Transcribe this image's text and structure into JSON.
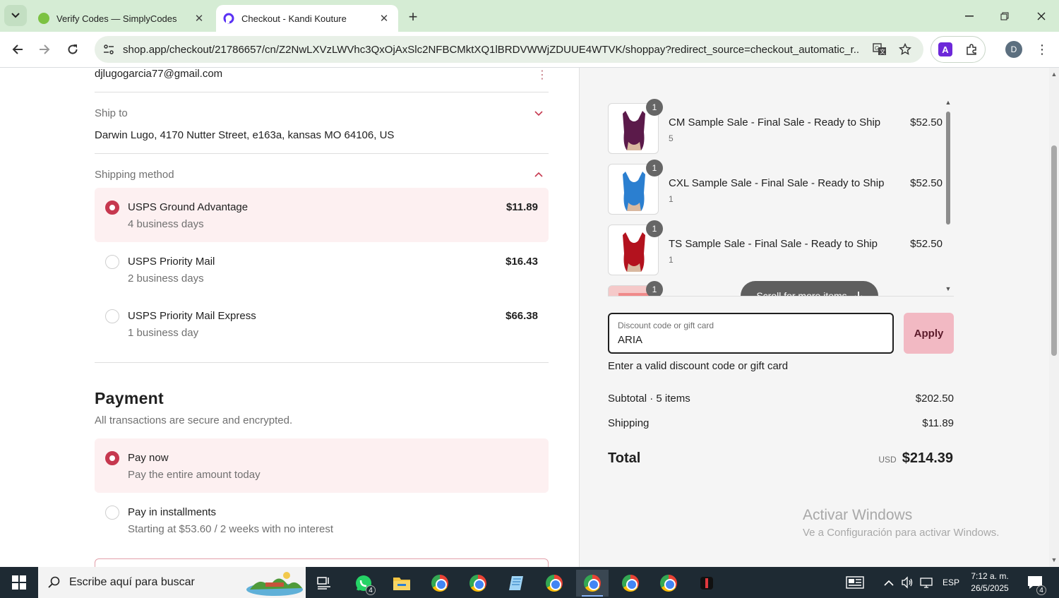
{
  "browser": {
    "tabs": [
      {
        "title": "Verify Codes — SimplyCodes",
        "active": false
      },
      {
        "title": "Checkout - Kandi Kouture",
        "active": true
      }
    ],
    "url": "shop.app/checkout/21786657/cn/Z2NwLXVzLWVhc3QxOjAxSlc2NFBCMktXQ1lBRDVWWjZDUUE4WTVK/shoppay?redirect_source=checkout_automatic_r...",
    "profile_initial": "D"
  },
  "contact": {
    "email": "djlugogarcia77@gmail.com"
  },
  "ship_to": {
    "label": "Ship to",
    "address": "Darwin Lugo, 4170 Nutter Street, e163a, kansas MO 64106, US"
  },
  "shipping": {
    "label": "Shipping method",
    "options": [
      {
        "title": "USPS Ground Advantage",
        "sub": "4 business days",
        "price": "$11.89",
        "selected": true
      },
      {
        "title": "USPS Priority Mail",
        "sub": "2 business days",
        "price": "$16.43",
        "selected": false
      },
      {
        "title": "USPS Priority Mail Express",
        "sub": "1 business day",
        "price": "$66.38",
        "selected": false
      }
    ]
  },
  "payment": {
    "heading": "Payment",
    "sub": "All transactions are secure and encrypted.",
    "options": [
      {
        "title": "Pay now",
        "sub": "Pay the entire amount today",
        "selected": true
      },
      {
        "title": "Pay in installments",
        "sub": "Starting at $53.60 / 2 weeks with no interest",
        "selected": false
      }
    ]
  },
  "order": {
    "items": [
      {
        "qty": "1",
        "name": "CM Sample Sale - Final Sale - Ready to Ship",
        "variant": "5",
        "price": "$52.50",
        "color": "#5b1a4a"
      },
      {
        "qty": "1",
        "name": "CXL Sample Sale - Final Sale - Ready to Ship",
        "variant": "1",
        "price": "$52.50",
        "color": "#2b7fd0"
      },
      {
        "qty": "1",
        "name": "TS Sample Sale - Final Sale - Ready to Ship",
        "variant": "1",
        "price": "$52.50",
        "color": "#b3121e"
      },
      {
        "qty": "1",
        "name": "",
        "variant": "",
        "price": "",
        "color": "#f08a8a"
      }
    ],
    "scroll_hint": "Scroll for more items",
    "discount": {
      "label": "Discount code or gift card",
      "value": "ARIA",
      "apply": "Apply",
      "error": "Enter a valid discount code or gift card"
    },
    "subtotal_label": "Subtotal · 5 items",
    "subtotal": "$202.50",
    "shipping_label": "Shipping",
    "shipping": "$11.89",
    "total_label": "Total",
    "currency": "USD",
    "total": "$214.39"
  },
  "watermark": {
    "line1": "Activar Windows",
    "line2": "Ve a Configuración para activar Windows."
  },
  "taskbar": {
    "search_placeholder": "Escribe aquí para buscar",
    "whatsapp_badge": "4",
    "language": "ESP",
    "time": "7:12 a. m.",
    "date": "26/5/2025",
    "notifications": "4"
  },
  "colors": {
    "accent": "#c6384f",
    "selected_bg": "#fdf0f1",
    "apply_bg": "#f2b9c3",
    "summary_bg": "#f5f5f5"
  }
}
